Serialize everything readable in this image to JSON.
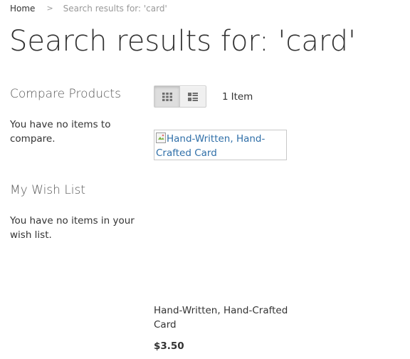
{
  "breadcrumb": {
    "home": "Home",
    "separator": ">",
    "current": "Search results for: 'card'"
  },
  "page": {
    "title": "Search results for: 'card'"
  },
  "sidebar": {
    "compare": {
      "title": "Compare Products",
      "empty_text": "You have no items to compare."
    },
    "wishlist": {
      "title": "My Wish List",
      "empty_text": "You have no items in your wish list."
    }
  },
  "toolbar": {
    "view_modes": [
      {
        "icon": "grid-icon",
        "active": true
      },
      {
        "icon": "list-icon",
        "active": false
      }
    ],
    "amount_number": "1",
    "amount_label": "Item"
  },
  "products": [
    {
      "image_alt": "Hand-Written, Hand-Crafted Card",
      "name": "Hand-Written, Hand-Crafted Card",
      "price": "$3.50"
    }
  ],
  "colors": {
    "text": "#333333",
    "muted": "#999999",
    "link": "#2f6fa8",
    "border": "#cccccc"
  }
}
